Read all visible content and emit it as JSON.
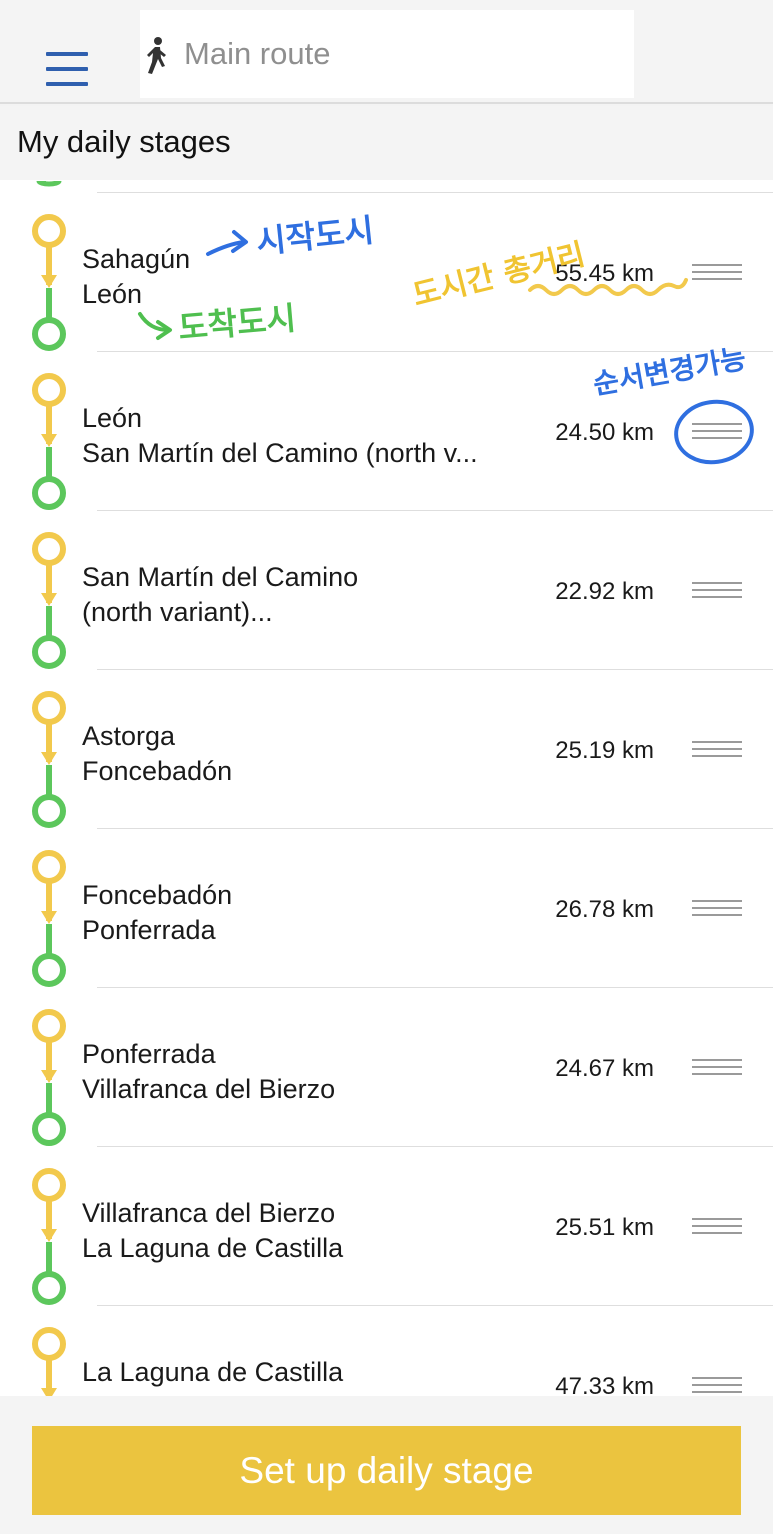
{
  "search": {
    "placeholder": "Main route",
    "icon": "walking-person-icon"
  },
  "section": {
    "title": "My daily stages"
  },
  "colors": {
    "start": "#f2c94c",
    "end": "#5cc75c",
    "accent": "#2f5fae",
    "cta": "#ebc43f"
  },
  "stages": [
    {
      "from": "Sahagún",
      "to": "León",
      "distance": "55.45 km"
    },
    {
      "from": "León",
      "to": "San Martín del Camino (north v...",
      "distance": "24.50 km"
    },
    {
      "from": "San Martín del Camino",
      "to": "(north variant)...",
      "distance": "22.92 km"
    },
    {
      "from": "Astorga",
      "to": "Foncebadón",
      "distance": "25.19 km"
    },
    {
      "from": "Foncebadón",
      "to": "Ponferrada",
      "distance": "26.78 km"
    },
    {
      "from": "Ponferrada",
      "to": "Villafranca del Bierzo",
      "distance": "24.67 km"
    },
    {
      "from": "Villafranca del Bierzo",
      "to": "La Laguna de Castilla",
      "distance": "25.51 km"
    },
    {
      "from": "La Laguna de Castilla",
      "to": "",
      "distance": "47.33 km"
    }
  ],
  "annotations": {
    "start_city": "시작도시",
    "arrival_city": "도착도시",
    "distance_between": "도시간 총거리",
    "reorder": "순서변경가능"
  },
  "cta": {
    "label": "Set up daily stage"
  }
}
